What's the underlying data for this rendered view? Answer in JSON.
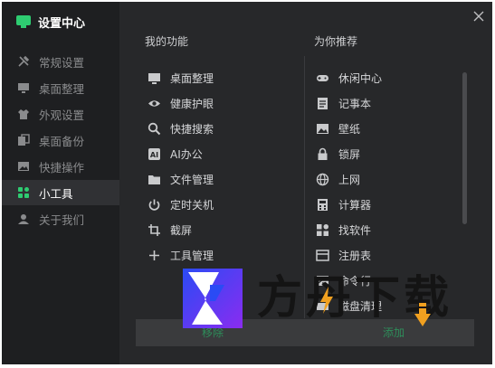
{
  "app": {
    "title": "设置中心"
  },
  "sidebar": {
    "items": [
      {
        "label": "常规设置",
        "icon": "tools-icon"
      },
      {
        "label": "桌面整理",
        "icon": "monitor-icon"
      },
      {
        "label": "外观设置",
        "icon": "shirt-icon"
      },
      {
        "label": "桌面备份",
        "icon": "backup-icon"
      },
      {
        "label": "快捷操作",
        "icon": "image-icon"
      },
      {
        "label": "小工具",
        "icon": "widgets-icon",
        "active": true
      },
      {
        "label": "关于我们",
        "icon": "user-icon"
      }
    ]
  },
  "features": {
    "heading": "我的功能",
    "items": [
      {
        "label": "桌面整理",
        "icon": "monitor-icon"
      },
      {
        "label": "健康护眼",
        "icon": "eye-icon"
      },
      {
        "label": "快捷搜索",
        "icon": "search-icon"
      },
      {
        "label": "AI办公",
        "icon": "ai-icon"
      },
      {
        "label": "文件管理",
        "icon": "folder-icon"
      },
      {
        "label": "定时关机",
        "icon": "power-icon"
      },
      {
        "label": "截屏",
        "icon": "crop-icon"
      },
      {
        "label": "工具管理",
        "icon": "plus-icon"
      }
    ]
  },
  "recommend": {
    "heading": "为你推荐",
    "items": [
      {
        "label": "休闲中心",
        "icon": "gamepad-icon"
      },
      {
        "label": "记事本",
        "icon": "notepad-icon"
      },
      {
        "label": "壁纸",
        "icon": "wallpaper-icon"
      },
      {
        "label": "锁屏",
        "icon": "lock-icon"
      },
      {
        "label": "上网",
        "icon": "globe-icon"
      },
      {
        "label": "计算器",
        "icon": "calculator-icon"
      },
      {
        "label": "找软件",
        "icon": "apps-icon"
      },
      {
        "label": "注册表",
        "icon": "registry-icon"
      },
      {
        "label": "命令行",
        "icon": "terminal-icon"
      },
      {
        "label": "磁盘清理",
        "icon": "disk-clean-icon"
      }
    ]
  },
  "buttons": {
    "remove": "移除",
    "add": "添加"
  },
  "watermark": {
    "text": "方丹下载"
  },
  "colors": {
    "accent": "#2ecc71",
    "panel": "#27282a",
    "sidebar": "#1e1f21",
    "active_item": "#303134"
  }
}
